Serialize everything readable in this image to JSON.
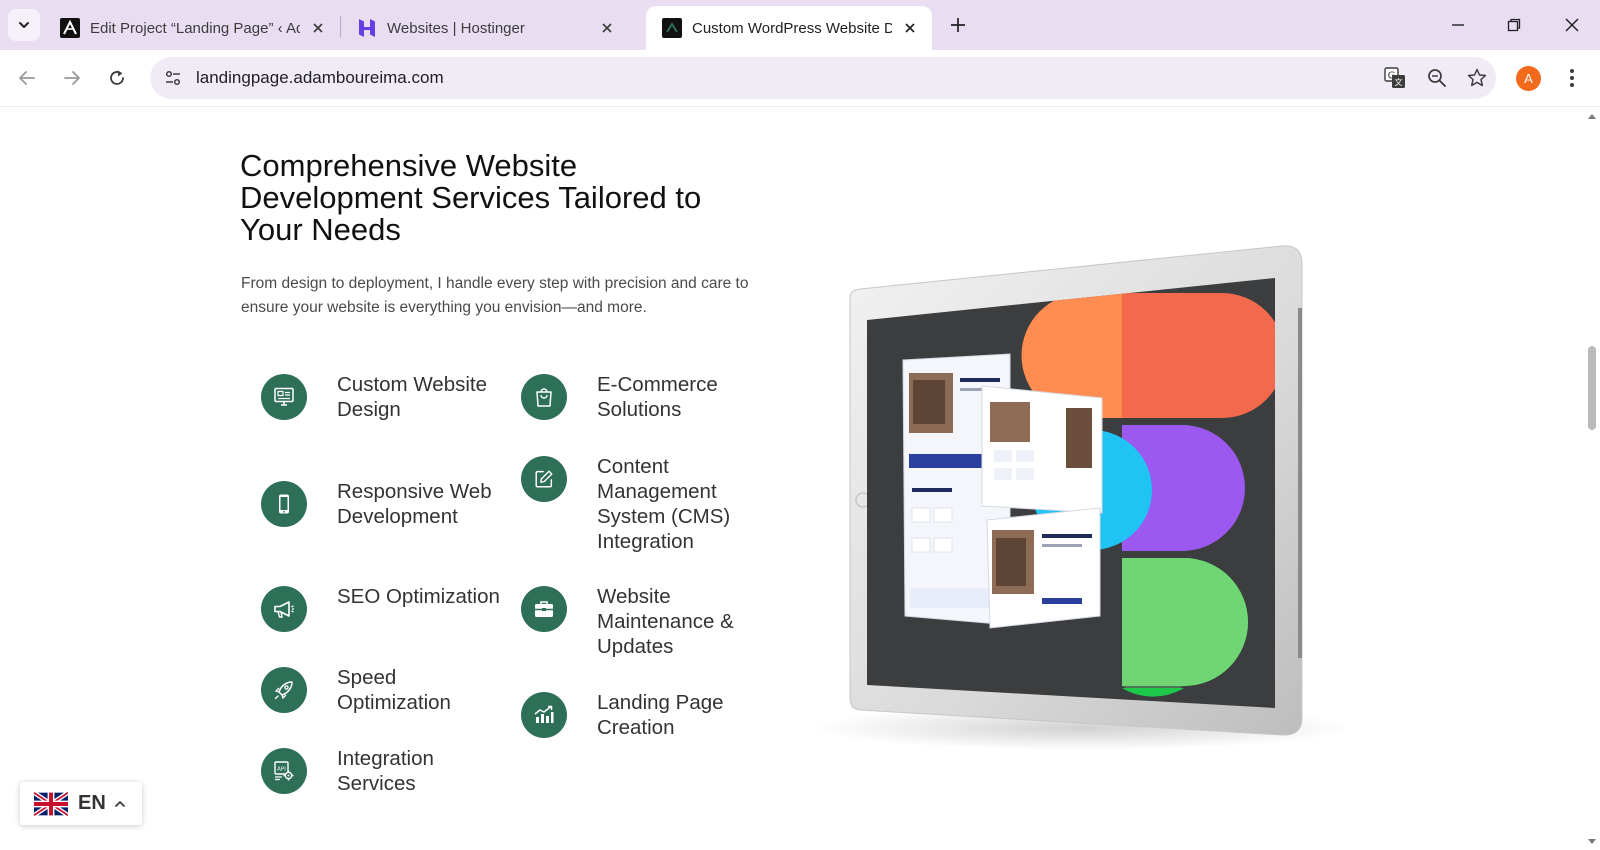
{
  "browser": {
    "tabs": [
      {
        "title": "Edit Project “Landing Page” ‹ Ad",
        "icon": "elementor-logo-icon",
        "active": false
      },
      {
        "title": "Websites | Hostinger",
        "icon": "hostinger-logo-icon",
        "active": false
      },
      {
        "title": "Custom WordPress Website Des",
        "icon": "site-favicon-icon",
        "active": true
      }
    ],
    "url": "landingpage.adamboureima.com",
    "profile_initial": "A",
    "accent_color": "#f26b1d"
  },
  "section": {
    "title": "Comprehensive Website Development Services Tailored to Your Needs",
    "description": "From design to deployment, I handle every step with precision and care to ensure your website is everything you envision—and more.",
    "icon_color": "#2e6f57",
    "services": [
      {
        "label": "Custom Website Design",
        "icon": "monitor-design-icon"
      },
      {
        "label": "E-Commerce Solutions",
        "icon": "shopping-bag-icon"
      },
      {
        "label": "Responsive Web Development",
        "icon": "mobile-phone-icon"
      },
      {
        "label": "Content Management System (CMS) Integration",
        "icon": "edit-square-icon"
      },
      {
        "label": "SEO Optimization",
        "icon": "megaphone-icon"
      },
      {
        "label": "Website Maintenance & Updates",
        "icon": "toolbox-icon"
      },
      {
        "label": "Speed Optimization",
        "icon": "rocket-icon"
      },
      {
        "label": "Landing Page Creation",
        "icon": "growth-chart-icon"
      },
      {
        "label": "Integration Services",
        "icon": "api-gear-icon"
      }
    ]
  },
  "language_switcher": {
    "label": "EN",
    "flag": "uk-flag-icon"
  }
}
